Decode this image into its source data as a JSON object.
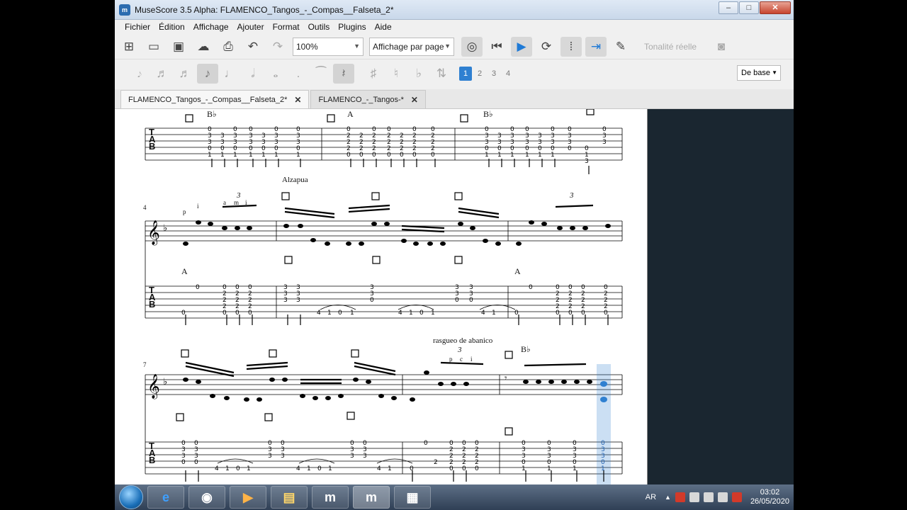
{
  "window": {
    "title": "MuseScore 3.5 Alpha: FLAMENCO_Tangos_-_Compas__Falseta_2*",
    "app_icon_text": "m",
    "minimize": "–",
    "maximize": "□",
    "close": "✕"
  },
  "menu": [
    "Fichier",
    "Édition",
    "Affichage",
    "Ajouter",
    "Format",
    "Outils",
    "Plugins",
    "Aide"
  ],
  "toolbar": {
    "zoom_value": "100%",
    "view_mode": "Affichage par page",
    "concert_pitch": "Tonalité réelle"
  },
  "note_toolbar": {
    "voices": [
      "1",
      "2",
      "3",
      "4"
    ],
    "workspace": "De base"
  },
  "tabs": [
    {
      "label": "FLAMENCO_Tangos_-_Compas__Falseta_2*",
      "close": "✕"
    },
    {
      "label": "FLAMENCO_-_Tangos-*",
      "close": "✕"
    }
  ],
  "score": {
    "chord_symbols": [
      "B♭",
      "A",
      "B♭",
      "A",
      "A",
      "B♭"
    ],
    "annotation_alzapua": "Alzapua",
    "annotation_rasgueo": "rasgueo de abanico",
    "measure_numbers": [
      "4",
      "7"
    ],
    "tuplet": "3",
    "fingerings": [
      "p",
      "i",
      "a",
      "m",
      "i",
      "p",
      "c",
      "i"
    ],
    "tab_label": [
      "T",
      "A",
      "B"
    ]
  },
  "taskbar": {
    "language": "AR",
    "time": "03:02",
    "date": "26/05/2020"
  },
  "colors": {
    "play_blue": "#1f7ad6",
    "selection_blue": "#2f80d1",
    "score_background": "#1a2630"
  }
}
